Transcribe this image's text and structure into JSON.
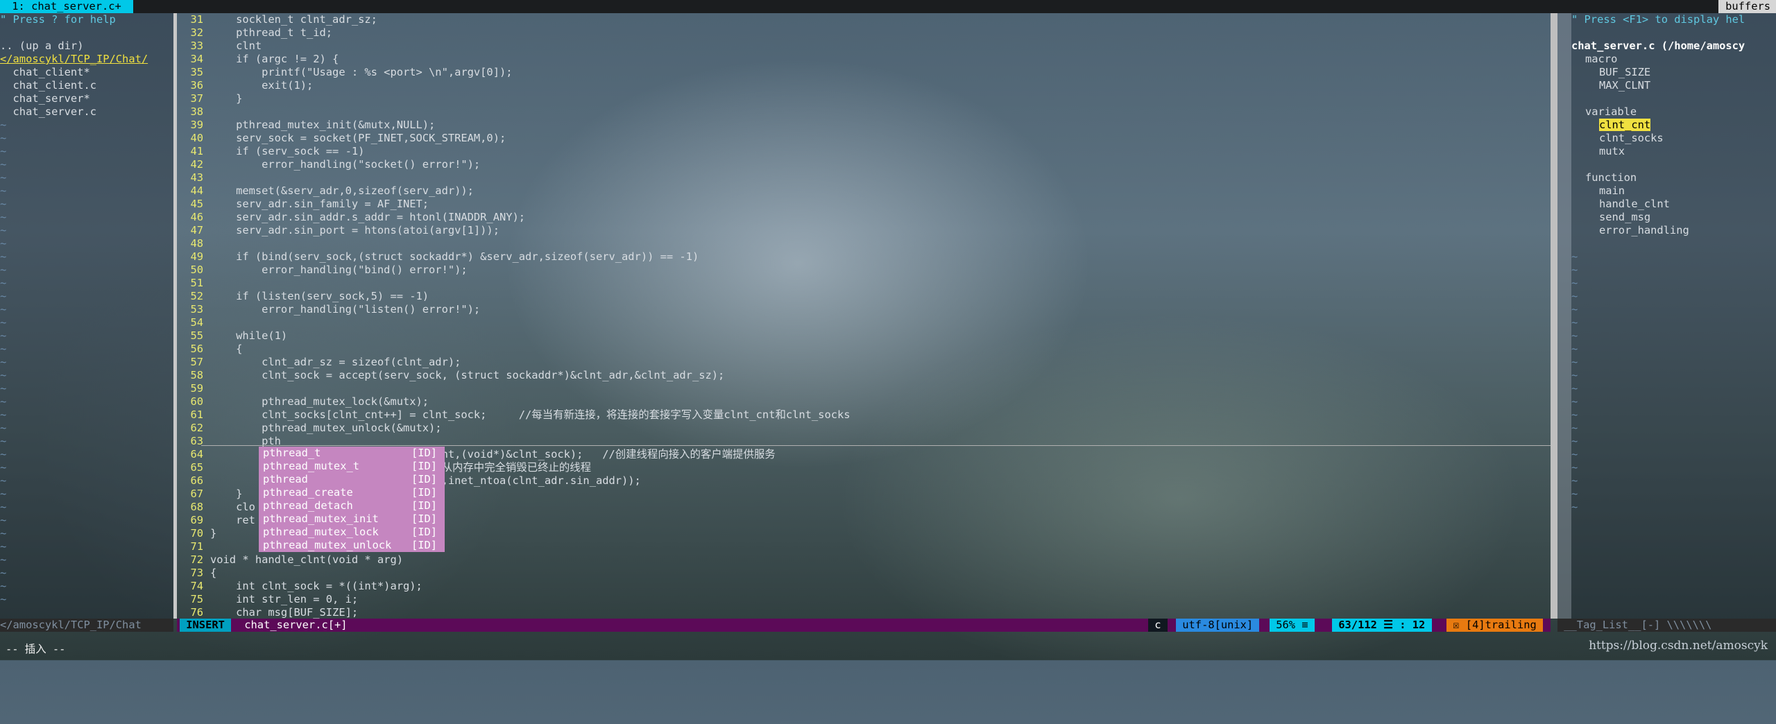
{
  "tabline": {
    "active_tab": " 1: chat_server.c+ ",
    "buffers_label": "buffers"
  },
  "nerdtree": {
    "help": "\" Press ? for help",
    "up_dir": ".. (up a dir)",
    "cwd": "</amoscykl/TCP_IP/Chat/",
    "files": [
      "  chat_client*",
      "  chat_client.c",
      "  chat_server*",
      "  chat_server.c"
    ],
    "status": "</amoscykl/TCP_IP/Chat"
  },
  "code": [
    {
      "n": "31",
      "t": "    socklen_t clnt_adr_sz;"
    },
    {
      "n": "32",
      "t": "    pthread_t t_id;"
    },
    {
      "n": "33",
      "t": "    clnt"
    },
    {
      "n": "34",
      "t": "    if (argc != 2) {"
    },
    {
      "n": "35",
      "t": "        printf(\"Usage : %s <port> \\n\",argv[0]);"
    },
    {
      "n": "36",
      "t": "        exit(1);"
    },
    {
      "n": "37",
      "t": "    }"
    },
    {
      "n": "38",
      "t": ""
    },
    {
      "n": "39",
      "t": "    pthread_mutex_init(&mutx,NULL);"
    },
    {
      "n": "40",
      "t": "    serv_sock = socket(PF_INET,SOCK_STREAM,0);"
    },
    {
      "n": "41",
      "t": "    if (serv_sock == -1)"
    },
    {
      "n": "42",
      "t": "        error_handling(\"socket() error!\");"
    },
    {
      "n": "43",
      "t": ""
    },
    {
      "n": "44",
      "t": "    memset(&serv_adr,0,sizeof(serv_adr));"
    },
    {
      "n": "45",
      "t": "    serv_adr.sin_family = AF_INET;"
    },
    {
      "n": "46",
      "t": "    serv_adr.sin_addr.s_addr = htonl(INADDR_ANY);"
    },
    {
      "n": "47",
      "t": "    serv_adr.sin_port = htons(atoi(argv[1]));"
    },
    {
      "n": "48",
      "t": ""
    },
    {
      "n": "49",
      "t": "    if (bind(serv_sock,(struct sockaddr*) &serv_adr,sizeof(serv_adr)) == -1)"
    },
    {
      "n": "50",
      "t": "        error_handling(\"bind() error!\");"
    },
    {
      "n": "51",
      "t": ""
    },
    {
      "n": "52",
      "t": "    if (listen(serv_sock,5) == -1)"
    },
    {
      "n": "53",
      "t": "        error_handling(\"listen() error!\");"
    },
    {
      "n": "54",
      "t": ""
    },
    {
      "n": "55",
      "t": "    while(1)"
    },
    {
      "n": "56",
      "t": "    {"
    },
    {
      "n": "57",
      "t": "        clnt_adr_sz = sizeof(clnt_adr);"
    },
    {
      "n": "58",
      "t": "        clnt_sock = accept(serv_sock, (struct sockaddr*)&clnt_adr,&clnt_adr_sz);"
    },
    {
      "n": "59",
      "t": ""
    },
    {
      "n": "60",
      "t": "        pthread_mutex_lock(&mutx);"
    },
    {
      "n": "61",
      "t": "        clnt_socks[clnt_cnt++] = clnt_sock;     //每当有新连接，将连接的套接字写入变量clnt_cnt和clnt_socks"
    },
    {
      "n": "62",
      "t": "        pthread_mutex_unlock(&mutx);"
    },
    {
      "n": "63",
      "t": "        pth"
    },
    {
      "n": "64",
      "t": "                           handle_clnt,(void*)&clnt_sock);   //创建线程向接入的客户端提供服务"
    },
    {
      "n": "65",
      "t": "                                  //从内存中完全销毁已终止的线程"
    },
    {
      "n": "66",
      "t": "                           P: %s \\n\",inet_ntoa(clnt_adr.sin_addr));"
    },
    {
      "n": "67",
      "t": "    }"
    },
    {
      "n": "68",
      "t": "    clo"
    },
    {
      "n": "69",
      "t": "    ret"
    },
    {
      "n": "70",
      "t": "}"
    },
    {
      "n": "71",
      "t": ""
    },
    {
      "n": "72",
      "t": "void * handle_clnt(void * arg)"
    },
    {
      "n": "73",
      "t": "{"
    },
    {
      "n": "74",
      "t": "    int clnt_sock = *((int*)arg);"
    },
    {
      "n": "75",
      "t": "    int str_len = 0, i;"
    },
    {
      "n": "76",
      "t": "    char msg[BUF_SIZE];"
    }
  ],
  "completion": [
    {
      "word": "pthread_t",
      "kind": "[ID]"
    },
    {
      "word": "pthread_mutex_t",
      "kind": "[ID]"
    },
    {
      "word": "pthread",
      "kind": "[ID]"
    },
    {
      "word": "pthread_create",
      "kind": "[ID]"
    },
    {
      "word": "pthread_detach",
      "kind": "[ID]"
    },
    {
      "word": "pthread_mutex_init",
      "kind": "[ID]"
    },
    {
      "word": "pthread_mutex_lock",
      "kind": "[ID]"
    },
    {
      "word": "pthread_mutex_unlock",
      "kind": "[ID]"
    }
  ],
  "taglist": {
    "help": "\" Press <F1> to display hel",
    "file": "chat_server.c (/home/amoscy",
    "groups": [
      {
        "name": "macro",
        "items": [
          "BUF_SIZE",
          "MAX_CLNT"
        ]
      },
      {
        "name": "variable",
        "items": [
          "clnt_cnt",
          "clnt_socks",
          "mutx"
        ]
      },
      {
        "name": "function",
        "items": [
          "main",
          "handle_clnt",
          "send_msg",
          "error_handling"
        ]
      }
    ],
    "selected": "clnt_cnt",
    "status": " __Tag_List__[-] \\\\\\\\\\\\\\"
  },
  "statusline": {
    "mode": " INSERT ",
    "filename": " chat_server.c[+] ",
    "filetype": " c ",
    "encoding": " utf-8[unix] ",
    "percent": " 56% ≡ ",
    "position": " 63/112 ☰ : 12 ",
    "trailing": " ☒ [4]trailing "
  },
  "cmdline": "-- 插入 --",
  "watermark": "https://blog.csdn.net/amoscyk",
  "colors": {
    "accent": "#00c8e8",
    "status_bg": "#5c0a58",
    "mode_bg": "#00a0c0",
    "popup": "#c586c0",
    "linenr": "#e8e870"
  }
}
